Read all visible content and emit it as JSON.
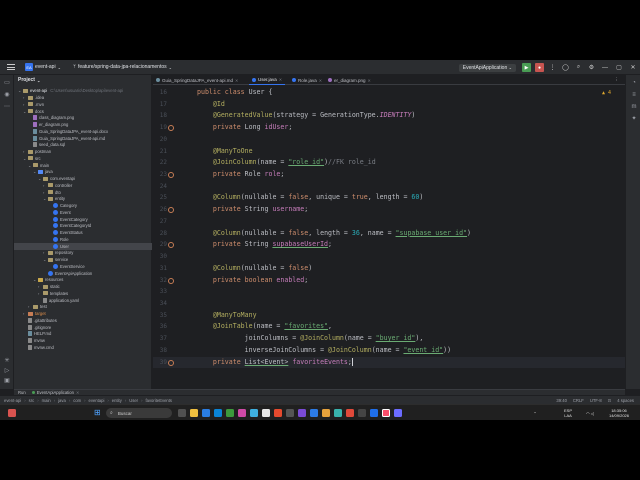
{
  "titlebar": {
    "project_badge": "EA",
    "project_name": "event-api",
    "branch": "feature/spring-data-jpa-relacionamentos",
    "run_config": "EventApiApplication",
    "window_controls": [
      "—",
      "▢",
      "✕"
    ]
  },
  "project_panel": {
    "title": "Project",
    "root": "event-api",
    "root_path": "C:\\Users\\usuario\\Desktop\\api\\event-api",
    "items": [
      {
        "label": ".idea",
        "kind": "folder",
        "depth": 1
      },
      {
        "label": ".mvn",
        "kind": "folder",
        "depth": 1
      },
      {
        "label": "docs",
        "kind": "folder",
        "depth": 1
      },
      {
        "label": "class_diagram.png",
        "kind": "img",
        "depth": 2
      },
      {
        "label": "er_diagram.png",
        "kind": "img",
        "depth": 2
      },
      {
        "label": "Guia_SpringDataJPA_event-api.docx",
        "kind": "doc",
        "depth": 2
      },
      {
        "label": "Guia_SpringDataJPA_event-api.md",
        "kind": "doc",
        "depth": 2
      },
      {
        "label": "seed_data.sql",
        "kind": "txt",
        "depth": 2
      },
      {
        "label": "postman",
        "kind": "folder",
        "depth": 1
      },
      {
        "label": "src",
        "kind": "folder",
        "depth": 1
      },
      {
        "label": "main",
        "kind": "folder",
        "depth": 2
      },
      {
        "label": "java",
        "kind": "folder-blue",
        "depth": 3
      },
      {
        "label": "com.eventapi",
        "kind": "folder",
        "depth": 4
      },
      {
        "label": "controller",
        "kind": "folder",
        "depth": 5
      },
      {
        "label": "dto",
        "kind": "folder",
        "depth": 5
      },
      {
        "label": "entity",
        "kind": "folder",
        "depth": 5
      },
      {
        "label": "Category",
        "kind": "class",
        "depth": 6
      },
      {
        "label": "Event",
        "kind": "class",
        "depth": 6
      },
      {
        "label": "EventCategory",
        "kind": "class",
        "depth": 6
      },
      {
        "label": "EventCategoryId",
        "kind": "class",
        "depth": 6
      },
      {
        "label": "EventStatus",
        "kind": "class",
        "depth": 6
      },
      {
        "label": "Role",
        "kind": "class",
        "depth": 6
      },
      {
        "label": "User",
        "kind": "class",
        "depth": 6,
        "selected": true
      },
      {
        "label": "repository",
        "kind": "folder",
        "depth": 5
      },
      {
        "label": "service",
        "kind": "folder",
        "depth": 5
      },
      {
        "label": "EventService",
        "kind": "class",
        "depth": 6
      },
      {
        "label": "EventApiApplication",
        "kind": "class",
        "depth": 5
      },
      {
        "label": "resources",
        "kind": "folder-res",
        "depth": 3
      },
      {
        "label": "static",
        "kind": "folder",
        "depth": 4
      },
      {
        "label": "templates",
        "kind": "folder",
        "depth": 4
      },
      {
        "label": "application.yaml",
        "kind": "txt",
        "depth": 4
      },
      {
        "label": "test",
        "kind": "folder",
        "depth": 2
      },
      {
        "label": "target",
        "kind": "folder-orange",
        "depth": 1
      },
      {
        "label": ".gitattributes",
        "kind": "txt",
        "depth": 1
      },
      {
        "label": ".gitignore",
        "kind": "txt",
        "depth": 1
      },
      {
        "label": "HELP.md",
        "kind": "doc",
        "depth": 1
      },
      {
        "label": "mvnw",
        "kind": "txt",
        "depth": 1
      },
      {
        "label": "mvnw.cmd",
        "kind": "txt",
        "depth": 1
      }
    ]
  },
  "tabs": [
    {
      "label": "Guia_SpringDataJPA_event-api.md",
      "active": false
    },
    {
      "label": "User.java",
      "active": true
    },
    {
      "label": "Role.java",
      "active": false
    },
    {
      "label": "er_diagram.png",
      "active": false
    }
  ],
  "editor": {
    "warnings": "▲ 4",
    "lines": [
      {
        "n": "16",
        "html": "<span class=\"kw\">public class</span> User {"
      },
      {
        "n": "17",
        "html": "    <span class=\"ann\">@Id</span>"
      },
      {
        "n": "18",
        "html": "    <span class=\"ann\">@GeneratedValue</span>(strategy = GenerationType.<span class=\"cst\">IDENTITY</span>)"
      },
      {
        "n": "19",
        "gutter": true,
        "html": "    <span class=\"kw\">private</span> Long <span class=\"fld\">idUser</span>;"
      },
      {
        "n": "20",
        "html": ""
      },
      {
        "n": "21",
        "html": "    <span class=\"ann\">@ManyToOne</span>"
      },
      {
        "n": "22",
        "html": "    <span class=\"ann\">@JoinColumn</span>(name = <span class=\"str ul\">\"role_id\"</span>)<span class=\"cmt\">//FK role_id</span>"
      },
      {
        "n": "23",
        "gutter": true,
        "html": "    <span class=\"kw\">private</span> Role <span class=\"fld\">role</span>;"
      },
      {
        "n": "24",
        "html": ""
      },
      {
        "n": "25",
        "html": "    <span class=\"ann\">@Column</span>(nullable = <span class=\"kw\">false</span>, unique = <span class=\"kw\">true</span>, length = <span class=\"num\">60</span>)"
      },
      {
        "n": "26",
        "gutter": true,
        "html": "    <span class=\"kw\">private</span> String <span class=\"fld\">username</span>;"
      },
      {
        "n": "27",
        "html": ""
      },
      {
        "n": "28",
        "html": "    <span class=\"ann\">@Column</span>(nullable = <span class=\"kw\">false</span>, length = <span class=\"num\">36</span>, name = <span class=\"str ul\">\"supabase_user_id\"</span>)"
      },
      {
        "n": "29",
        "gutter": true,
        "html": "    <span class=\"kw\">private</span> String <span class=\"fld ul\">supabaseUserId</span>;"
      },
      {
        "n": "30",
        "html": ""
      },
      {
        "n": "31",
        "html": "    <span class=\"ann\">@Column</span>(nullable = <span class=\"kw\">false</span>)"
      },
      {
        "n": "32",
        "gutter": true,
        "html": "    <span class=\"kw\">private boolean</span> <span class=\"fld\">enabled</span>;"
      },
      {
        "n": "33",
        "html": ""
      },
      {
        "n": "34",
        "html": ""
      },
      {
        "n": "35",
        "html": "    <span class=\"ann\">@ManyToMany</span>"
      },
      {
        "n": "36",
        "html": "    <span class=\"ann\">@JoinTable</span>(name = <span class=\"str ul\">\"favorites\"</span>,"
      },
      {
        "n": "37",
        "html": "            joinColumns = <span class=\"ann\">@JoinColumn</span>(name = <span class=\"str ul\">\"buyer_id\"</span>),"
      },
      {
        "n": "38",
        "html": "            inverseJoinColumns = <span class=\"ann\">@JoinColumn</span>(name = <span class=\"str ul\">\"event_id\"</span>))"
      },
      {
        "n": "39",
        "gutter": true,
        "current": true,
        "html": "    <span class=\"kw\">private</span> <span class=\"ul\">List&lt;Event&gt;</span> <span class=\"fld\">favoriteEvents</span>;<span class=\"cursor\"></span>"
      }
    ]
  },
  "runbar": {
    "label": "Run",
    "tab": "EventApiApplication"
  },
  "statusbar": {
    "breadcrumbs": [
      "event-api",
      "src",
      "main",
      "java",
      "com",
      "eventapi",
      "entity",
      "User",
      "favoriteEvents"
    ],
    "position": "39:40",
    "line_sep": "CRLF",
    "encoding": "UTF-8",
    "indent": "4 spaces"
  },
  "taskbar": {
    "search_placeholder": "Buscar",
    "lang": "ESP",
    "lang2": "LAA",
    "time": "18:35:06",
    "date": "14/09/2026"
  }
}
